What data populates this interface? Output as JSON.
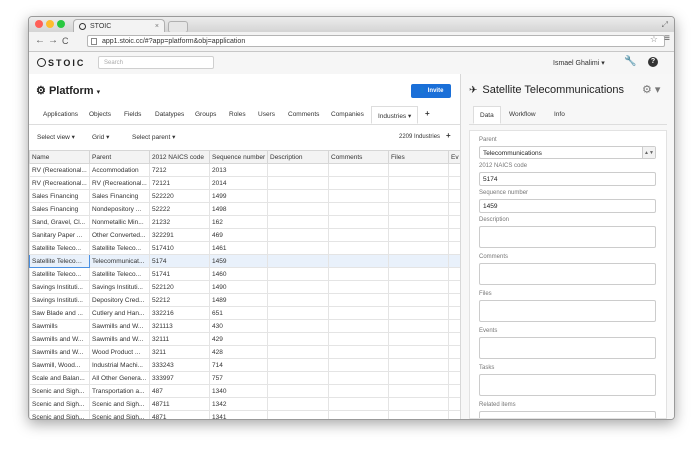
{
  "browser": {
    "tab_title": "STOIC",
    "url": "app1.stoic.cc/#?app=platform&obj=application",
    "colors": {
      "close": "#ff5f57",
      "minimize": "#febc2e",
      "maximize": "#28c840"
    }
  },
  "app": {
    "logo_text": "STOIC",
    "search_placeholder": "Search",
    "user_name": "Ismael Ghalimi ▾"
  },
  "left": {
    "title": "Platform",
    "title_caret": "▾",
    "invite_label": "Invite",
    "tabs": [
      "Applications",
      "Objects",
      "Fields",
      "Datatypes",
      "Groups",
      "Roles",
      "Users",
      "Comments",
      "Companies"
    ],
    "active_tab": "Industries ▾",
    "filters": {
      "view": "Select view ▾",
      "grid": "Grid ▾",
      "parent": "Select parent ▾",
      "count": "2209 Industries"
    },
    "columns": [
      "Name",
      "Parent",
      "2012 NAICS code",
      "Sequence number",
      "Description",
      "Comments",
      "Files",
      "Ev"
    ],
    "rows": [
      [
        "RV (Recreational...",
        "Accommodation",
        "7212",
        "2013"
      ],
      [
        "RV (Recreational...",
        "RV (Recreational...",
        "72121",
        "2014"
      ],
      [
        "Sales Financing",
        "Sales Financing",
        "522220",
        "1499"
      ],
      [
        "Sales Financing",
        "Nondepository ...",
        "52222",
        "1498"
      ],
      [
        "Sand, Gravel, Cl...",
        "Nonmetallic Min...",
        "21232",
        "162"
      ],
      [
        "Sanitary Paper ...",
        "Other Converted...",
        "322291",
        "469"
      ],
      [
        "Satellite Teleco...",
        "Satellite Teleco...",
        "517410",
        "1461"
      ],
      [
        "Satellite Telecommu",
        "Telecommunicat...",
        "5174",
        "1459"
      ],
      [
        "Satellite Teleco...",
        "Satellite Teleco...",
        "51741",
        "1460"
      ],
      [
        "Savings Instituti...",
        "Savings Instituti...",
        "522120",
        "1490"
      ],
      [
        "Savings Instituti...",
        "Depository Cred...",
        "52212",
        "1489"
      ],
      [
        "Saw Blade and ...",
        "Cutlery and Han...",
        "332216",
        "651"
      ],
      [
        "Sawmills",
        "Sawmills and W...",
        "321113",
        "430"
      ],
      [
        "Sawmills and W...",
        "Sawmills and W...",
        "32111",
        "429"
      ],
      [
        "Sawmills and W...",
        "Wood Product ...",
        "3211",
        "428"
      ],
      [
        "Sawmill, Wood...",
        "Industrial Machi...",
        "333243",
        "714"
      ],
      [
        "Scale and Balan...",
        "All Other Genera...",
        "333997",
        "757"
      ],
      [
        "Scenic and Sigh...",
        "Transportation a...",
        "487",
        "1340"
      ],
      [
        "Scenic and Sigh...",
        "Scenic and Sigh...",
        "48711",
        "1342"
      ],
      [
        "Scenic and Sigh...",
        "Scenic and Sigh...",
        "4871",
        "1341"
      ]
    ],
    "selected_row": 7
  },
  "right": {
    "title": "Satellite Telecommunications",
    "tabs": [
      "Data",
      "Workflow",
      "Info"
    ],
    "fields": {
      "parent_label": "Parent",
      "parent_value": "Telecommunications",
      "naics_label": "2012 NAICS code",
      "naics_value": "5174",
      "sequence_label": "Sequence number",
      "sequence_value": "1459",
      "description_label": "Description",
      "comments_label": "Comments",
      "files_label": "Files",
      "events_label": "Events",
      "tasks_label": "Tasks",
      "related_label": "Related items"
    }
  }
}
